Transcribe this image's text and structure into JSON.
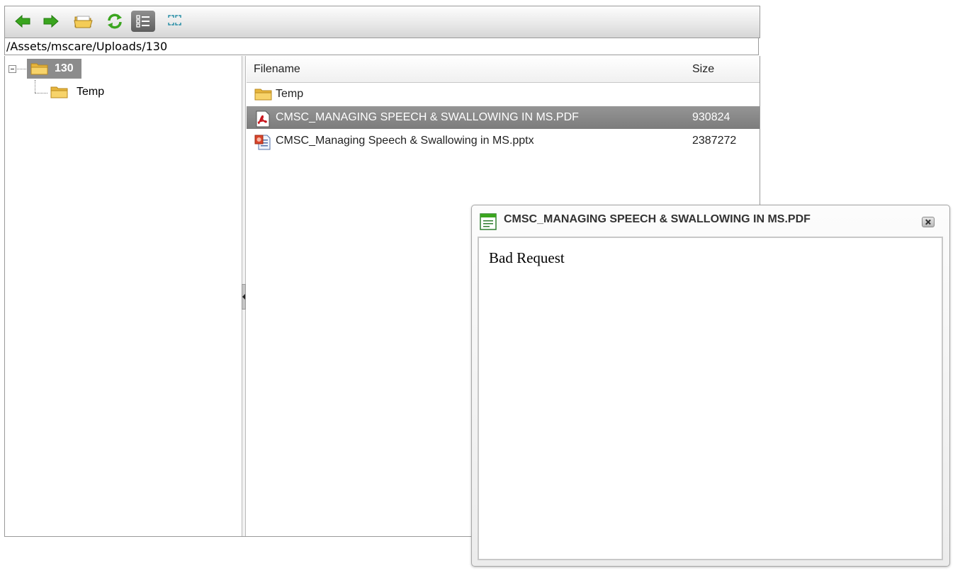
{
  "toolbar": {
    "buttons": [
      "back",
      "forward",
      "open-folder",
      "refresh",
      "details-view",
      "thumbnails-view"
    ],
    "active": "details-view"
  },
  "path": "/Assets/mscare/Uploads/130",
  "tree": {
    "root": "130",
    "children": [
      "Temp"
    ]
  },
  "file_list": {
    "headers": {
      "filename": "Filename",
      "size": "Size"
    },
    "rows": [
      {
        "name": "Temp",
        "size": "",
        "type": "folder"
      },
      {
        "name": "CMSC_MANAGING SPEECH & SWALLOWING IN MS.PDF",
        "size": "930824",
        "type": "pdf",
        "selected": true
      },
      {
        "name": "CMSC_Managing Speech & Swallowing in MS.pptx",
        "size": "2387272",
        "type": "pptx"
      }
    ]
  },
  "dialog": {
    "title": "CMSC_MANAGING SPEECH & SWALLOWING IN MS.PDF",
    "message": "Bad Request"
  },
  "colors": {
    "selection": "#888888",
    "arrow_green": "#3aa51e",
    "folder_yellow": "#f2c443"
  }
}
